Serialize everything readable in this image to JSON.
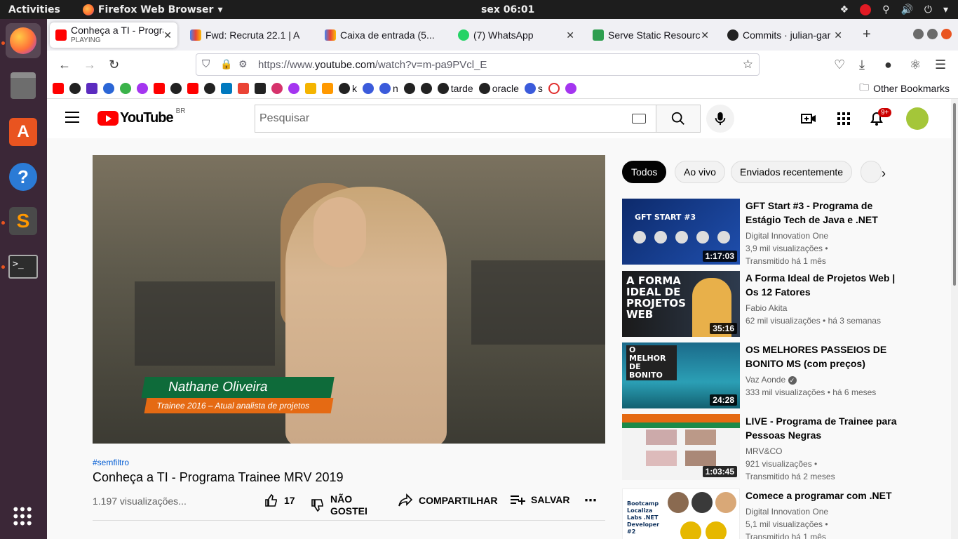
{
  "topbar": {
    "activities": "Activities",
    "app_name": "Firefox Web Browser",
    "clock": "sex 06:01"
  },
  "tabs": [
    {
      "title": "Conheça a TI - Progra",
      "subtitle": "PLAYING"
    },
    {
      "title": "Fwd: Recruta 22.1 | A"
    },
    {
      "title": "Caixa de entrada (5..."
    },
    {
      "title": "(7) WhatsApp"
    },
    {
      "title": "Serve Static Resourc"
    },
    {
      "title": "Commits · julian-gar"
    }
  ],
  "address": {
    "prefix": "https://www.",
    "domain": "youtube.com",
    "path": "/watch?v=m-pa9PVcl_E"
  },
  "bookmarks": {
    "items": [
      "k",
      "n",
      "tarde",
      "oracle",
      "s"
    ],
    "other": "Other Bookmarks"
  },
  "youtube": {
    "logo_text": "YouTube",
    "region": "BR",
    "search_placeholder": "Pesquisar",
    "notif_count": "9+"
  },
  "video": {
    "lower_third_name": "Nathane Oliveira",
    "lower_third_role": "Trainee 2016 – Atual analista de projetos",
    "hashtag": "#semfiltro",
    "title": "Conheça a TI - Programa Trainee MRV 2019",
    "views": "1.197 visualizações...",
    "likes": "17",
    "dislike_label": "NÃO GOSTEI",
    "share_label": "COMPARTILHAR",
    "save_label": "SALVAR"
  },
  "chips": [
    "Todos",
    "Ao vivo",
    "Enviados recentemente"
  ],
  "recommendations": [
    {
      "title": "GFT Start #3 - Programa de Estágio Tech de Java e .NET",
      "channel": "Digital Innovation One",
      "meta1": "3,9 mil visualizações •",
      "meta2": "Transmitido há 1 mês",
      "duration": "1:17:03",
      "thumb_text": "GFT START #3"
    },
    {
      "title": "A Forma Ideal de Projetos Web | Os 12 Fatores",
      "channel": "Fabio Akita",
      "meta1": "62 mil visualizações • há 3 semanas",
      "meta2": "",
      "duration": "35:16",
      "thumb_text": "A FORMA IDEAL DE PROJETOS WEB"
    },
    {
      "title": "OS MELHORES PASSEIOS DE BONITO MS (com preços)",
      "channel": "Vaz Aonde",
      "meta1": "333 mil visualizações • há 6 meses",
      "meta2": "",
      "duration": "24:28",
      "thumb_text": "O MELHOR DE BONITO"
    },
    {
      "title": "LIVE - Programa de Trainee para Pessoas Negras",
      "channel": "MRV&CO",
      "meta1": "921 visualizações •",
      "meta2": "Transmitido há 2 meses",
      "duration": "1:03:45",
      "thumb_text": ""
    },
    {
      "title": "Comece a programar com .NET",
      "channel": "Digital Innovation One",
      "meta1": "5,1 mil visualizações •",
      "meta2": "Transmitido há 1 mês",
      "duration": "",
      "thumb_text": "Bootcamp Localiza Labs .NET Developer #2"
    }
  ]
}
